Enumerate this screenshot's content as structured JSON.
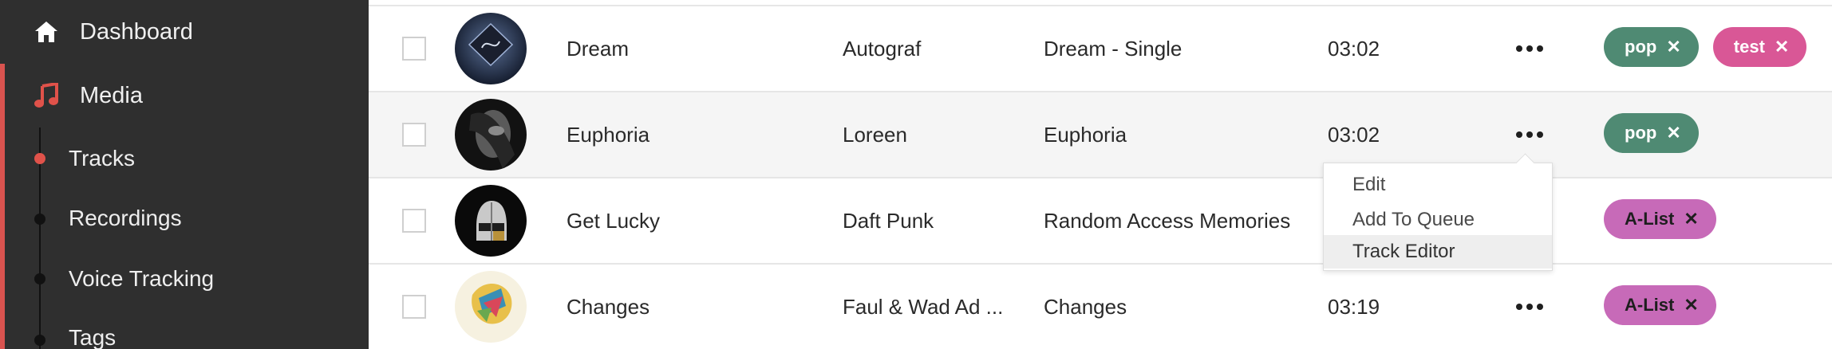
{
  "sidebar": {
    "dashboard_label": "Dashboard",
    "media_label": "Media",
    "sub_items": [
      {
        "label": "Tracks",
        "active": true
      },
      {
        "label": "Recordings",
        "active": false
      },
      {
        "label": "Voice Tracking",
        "active": false
      },
      {
        "label": "Tags",
        "active": false
      }
    ],
    "icons": {
      "dashboard": "home-icon",
      "media": "music-note-icon"
    },
    "colors": {
      "background": "#2f2f2f",
      "accent": "#e0524a"
    }
  },
  "tracks": [
    {
      "title": "Dream",
      "artist": "Autograf",
      "album": "Dream - Single",
      "duration": "03:02",
      "tags": [
        {
          "label": "pop",
          "color": "#4f8a73"
        },
        {
          "label": "test",
          "color": "#d95796"
        }
      ]
    },
    {
      "title": "Euphoria",
      "artist": "Loreen",
      "album": "Euphoria",
      "duration": "03:02",
      "tags": [
        {
          "label": "pop",
          "color": "#4f8a73"
        }
      ]
    },
    {
      "title": "Get Lucky",
      "artist": "Daft Punk",
      "album": "Random Access Memories",
      "duration": "",
      "tags": [
        {
          "label": "A-List",
          "color": "#c76ab8"
        }
      ]
    },
    {
      "title": "Changes",
      "artist": "Faul & Wad Ad ...",
      "album": "Changes",
      "duration": "03:19",
      "tags": [
        {
          "label": "A-List",
          "color": "#c76ab8"
        }
      ]
    }
  ],
  "tag_remove_glyph": "✕",
  "context_menu": {
    "items": [
      "Edit",
      "Add To Queue",
      "Track Editor"
    ],
    "highlighted": "Track Editor"
  }
}
